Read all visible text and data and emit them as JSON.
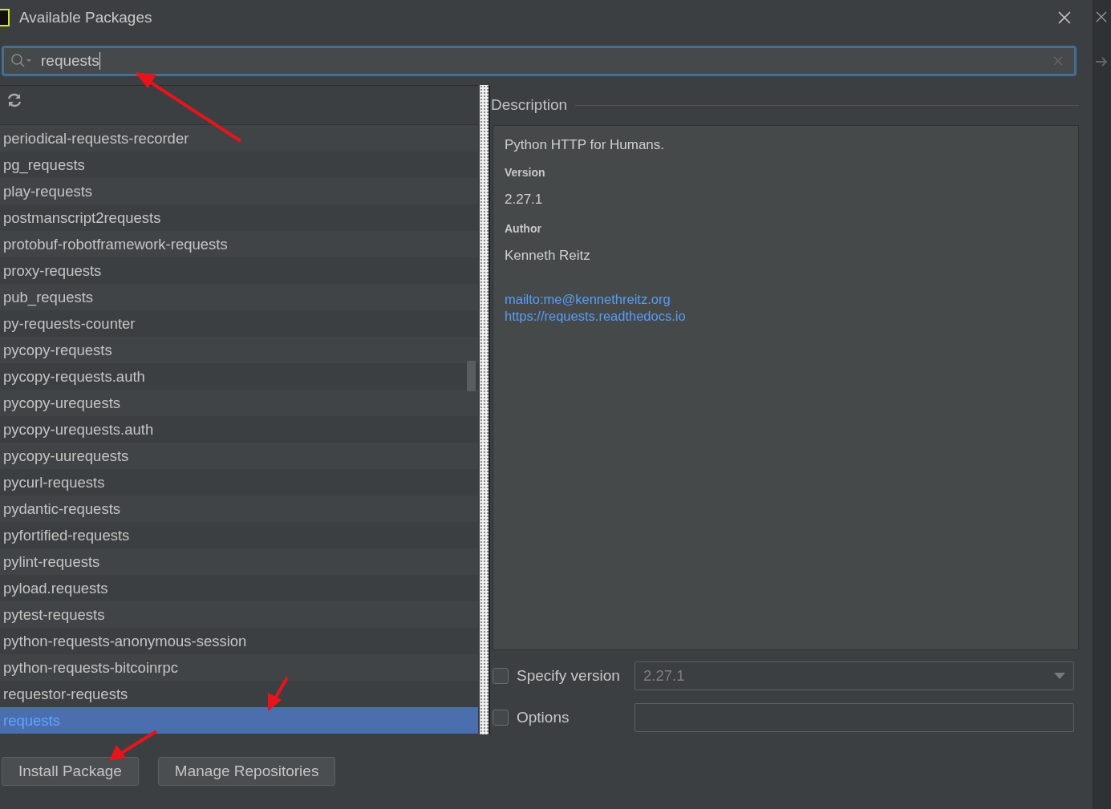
{
  "window": {
    "title": "Available Packages"
  },
  "search": {
    "value": "requests"
  },
  "packages": [
    {
      "name": "periodical-requests-recorder",
      "selected": false
    },
    {
      "name": "pg_requests",
      "selected": false
    },
    {
      "name": "play-requests",
      "selected": false
    },
    {
      "name": "postmanscript2requests",
      "selected": false
    },
    {
      "name": "protobuf-robotframework-requests",
      "selected": false
    },
    {
      "name": "proxy-requests",
      "selected": false
    },
    {
      "name": "pub_requests",
      "selected": false
    },
    {
      "name": "py-requests-counter",
      "selected": false
    },
    {
      "name": "pycopy-requests",
      "selected": false
    },
    {
      "name": "pycopy-requests.auth",
      "selected": false
    },
    {
      "name": "pycopy-urequests",
      "selected": false
    },
    {
      "name": "pycopy-urequests.auth",
      "selected": false
    },
    {
      "name": "pycopy-uurequests",
      "selected": false
    },
    {
      "name": "pycurl-requests",
      "selected": false
    },
    {
      "name": "pydantic-requests",
      "selected": false
    },
    {
      "name": "pyfortified-requests",
      "selected": false
    },
    {
      "name": "pylint-requests",
      "selected": false
    },
    {
      "name": "pyload.requests",
      "selected": false
    },
    {
      "name": "pytest-requests",
      "selected": false
    },
    {
      "name": "python-requests-anonymous-session",
      "selected": false
    },
    {
      "name": "python-requests-bitcoinrpc",
      "selected": false
    },
    {
      "name": "requestor-requests",
      "selected": false
    },
    {
      "name": "requests",
      "selected": true
    }
  ],
  "description": {
    "heading": "Description",
    "summary": "Python HTTP for Humans.",
    "fields": [
      {
        "label": "Version",
        "value": "2.27.1"
      },
      {
        "label": "Author",
        "value": "Kenneth Reitz"
      }
    ],
    "links": [
      "mailto:me@kennethreitz.org",
      "https://requests.readthedocs.io"
    ]
  },
  "options": [
    {
      "kind": "dropdown",
      "label": "Specify version",
      "checked": false,
      "value": "2.27.1"
    },
    {
      "kind": "text",
      "label": "Options",
      "checked": false
    }
  ],
  "buttons": [
    "Install Package",
    "Manage Repositories"
  ]
}
